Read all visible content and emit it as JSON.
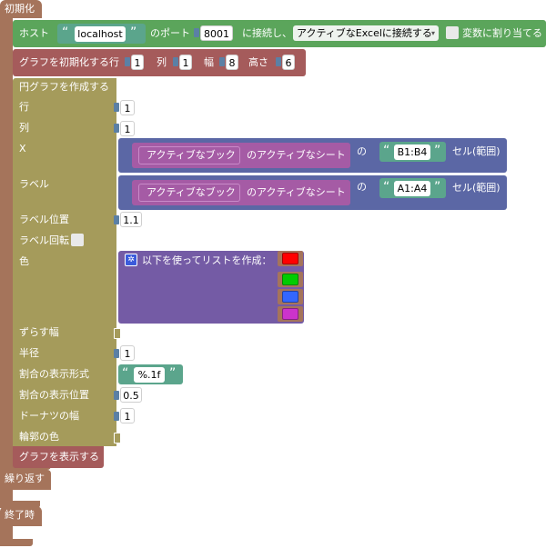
{
  "events": {
    "init": "初期化",
    "repeat": "繰り返す",
    "finish": "終了時"
  },
  "connect": {
    "host_label": "ホスト",
    "host_value": "localhost",
    "port_label": "のポート",
    "port_value": "8001",
    "connect_label": "に接続し、",
    "mode_value": "アクティブなExcelに接続する",
    "assign_label": "変数に割り当てる"
  },
  "init_chart": {
    "label": "グラフを初期化する",
    "row_label": "行",
    "row_value": "1",
    "col_label": "列",
    "col_value": "1",
    "width_label": "幅",
    "width_value": "8",
    "height_label": "高さ",
    "height_value": "6"
  },
  "pie_chart": {
    "title": "円グラフを作成する",
    "row_label": "行",
    "row_value": "1",
    "col_label": "列",
    "col_value": "1",
    "x_label": "X",
    "label_label": "ラベル",
    "label_pos_label": "ラベル位置",
    "label_pos_value": "1.1",
    "label_rot_label": "ラベル回転",
    "color_label": "色",
    "explode_label": "ずらす幅",
    "radius_label": "半径",
    "radius_value": "1",
    "pct_format_label": "割合の表示形式",
    "pct_format_value": "%.1f",
    "pct_pos_label": "割合の表示位置",
    "pct_pos_value": "0.5",
    "donut_label": "ドーナツの幅",
    "donut_value": "1",
    "edge_color_label": "輪郭の色"
  },
  "range_x": {
    "book": "アクティブなブック",
    "sheet": "のアクティブなシート",
    "of": "の",
    "range": "B1:B4",
    "cells": "セル(範囲)"
  },
  "range_label": {
    "book": "アクティブなブック",
    "sheet": "のアクティブなシート",
    "of": "の",
    "range": "A1:A4",
    "cells": "セル(範囲)"
  },
  "list": {
    "label": "以下を使ってリストを作成：",
    "colors": [
      "#ff0000",
      "#00cc00",
      "#3366ff",
      "#cc33cc"
    ]
  },
  "show_chart": {
    "label": "グラフを表示する"
  },
  "colors": {
    "event": "#a5745b",
    "connect": "#5ba55b",
    "chart": "#a59b5b",
    "init": "#a55b5b",
    "range": "#5b67a5",
    "book": "#a55ba5",
    "text": "#5ba58c",
    "list": "#745ba5",
    "color": "#a5745b"
  }
}
